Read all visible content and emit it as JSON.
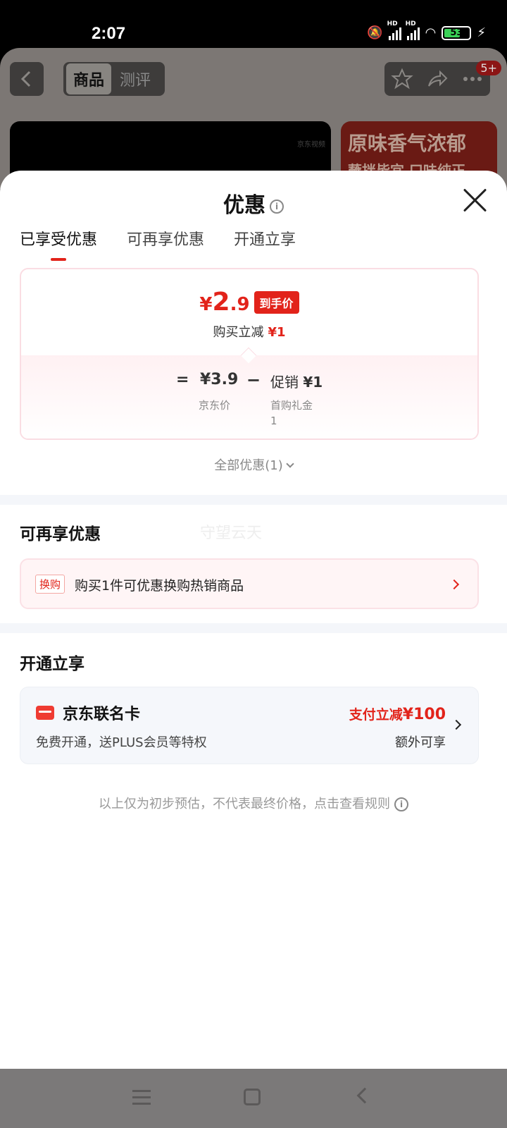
{
  "status_bar": {
    "time": "2:07",
    "battery": "53",
    "signal_label": "HD"
  },
  "background_page": {
    "tabs": [
      "商品",
      "测评"
    ],
    "badge": "5+",
    "video_logo": "京东视频",
    "ad_line1": "原味香气浓郁",
    "ad_line2": "蘸拌皆宜 口味纯正"
  },
  "sheet": {
    "title": "优惠",
    "tabs": [
      "已享受优惠",
      "可再享优惠",
      "开通立享"
    ],
    "active_tab_index": 0,
    "final_price": {
      "currency": "¥",
      "integer": "2",
      "decimal": ".9",
      "tag": "到手价"
    },
    "reduce_text": "购买立减",
    "reduce_amount": "¥1",
    "calc": {
      "equals": "=",
      "original_price": "¥3.9",
      "original_label": "京东价",
      "minus": "−",
      "promo_text": "促销",
      "promo_amount": "¥1",
      "promo_label": "首购礼金",
      "promo_sub": "1"
    },
    "all_discount": "全部优惠(1)",
    "section_more": "可再享优惠",
    "watermark": "守望云天",
    "swap": {
      "tag": "换购",
      "text": "购买1件可优惠换购热销商品"
    },
    "section_open": "开通立享",
    "card": {
      "name": "京东联名卡",
      "desc": "免费开通，送PLUS会员等特权",
      "offer_text": "支付立减",
      "offer_amount": "¥100",
      "extra": "额外可享"
    },
    "footer_note": "以上仅为初步预估，不代表最终价格，点击查看规则"
  },
  "colors": {
    "accent": "#e2231a",
    "card_bg": "#f5f7fb",
    "swap_bg": "#fff5f6"
  }
}
